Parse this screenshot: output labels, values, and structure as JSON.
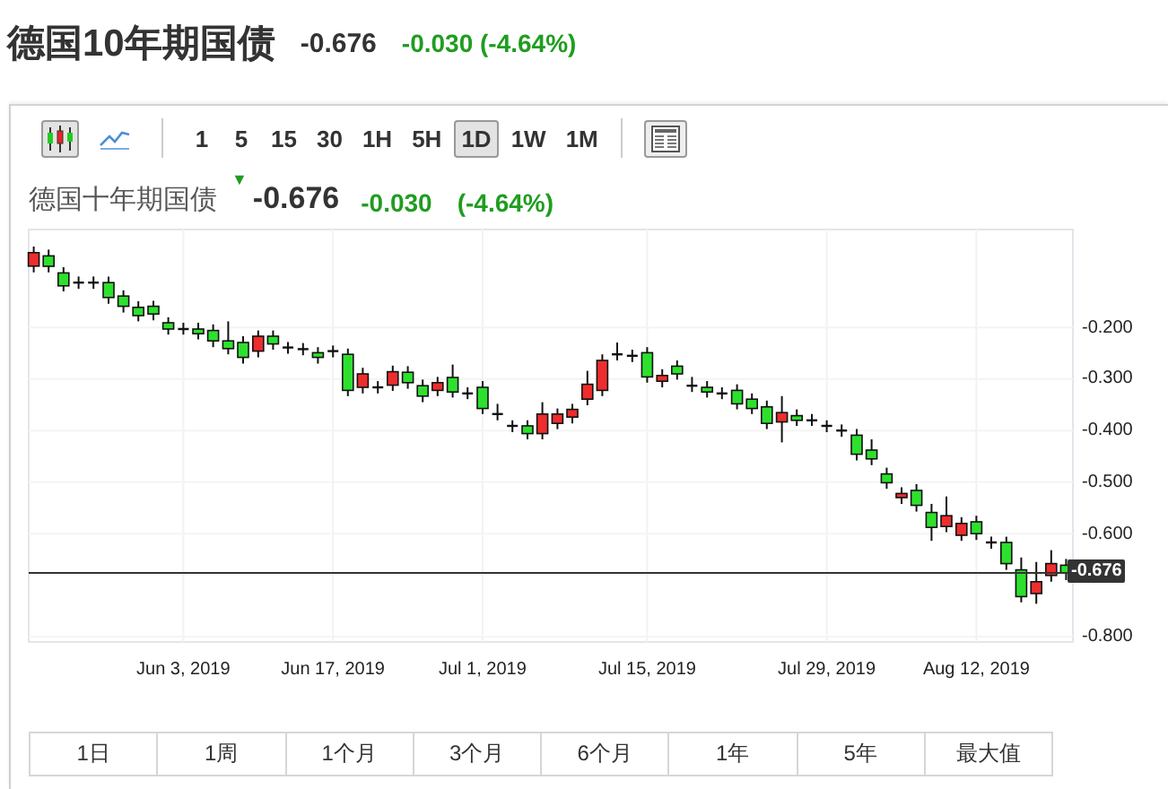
{
  "title": "德国10年期国债",
  "price": "-0.676",
  "change": "-0.030 (-4.64%)",
  "toolbar": {
    "chart_types": [
      {
        "kind": "candle",
        "selected": true
      },
      {
        "kind": "line",
        "selected": false
      }
    ],
    "intervals": [
      {
        "label": "1",
        "selected": false
      },
      {
        "label": "5",
        "selected": false
      },
      {
        "label": "15",
        "selected": false
      },
      {
        "label": "30",
        "selected": false
      },
      {
        "label": "1H",
        "selected": false
      },
      {
        "label": "5H",
        "selected": false
      },
      {
        "label": "1D",
        "selected": true
      },
      {
        "label": "1W",
        "selected": false
      },
      {
        "label": "1M",
        "selected": false
      }
    ]
  },
  "chart": {
    "name": "德国十年期国债",
    "trend_arrow": "▼",
    "price": "-0.676",
    "change": "-0.030",
    "change_percent": "(-4.64%)",
    "chart_data": {
      "type": "candlestick",
      "categories": [
        null,
        null,
        null,
        null,
        null,
        null,
        null,
        null,
        null,
        null,
        "Jun 3, 2019",
        null,
        null,
        null,
        null,
        null,
        null,
        null,
        null,
        null,
        "Jun 17, 2019",
        null,
        null,
        null,
        null,
        null,
        null,
        null,
        null,
        null,
        "Jul 1, 2019",
        null,
        null,
        null,
        null,
        null,
        null,
        null,
        null,
        null,
        null,
        "Jul 15, 2019",
        null,
        null,
        null,
        null,
        null,
        null,
        null,
        null,
        null,
        null,
        null,
        "Jul 29, 2019",
        null,
        null,
        null,
        null,
        null,
        null,
        null,
        null,
        null,
        "Aug 12, 2019",
        null,
        null,
        null,
        null,
        null,
        null
      ],
      "ohlc": [
        [
          -0.081,
          -0.043,
          -0.093,
          -0.055
        ],
        [
          -0.061,
          -0.049,
          -0.093,
          -0.081
        ],
        [
          -0.094,
          -0.083,
          -0.13,
          -0.119
        ],
        [
          -0.113,
          -0.101,
          -0.125,
          -0.113
        ],
        [
          -0.113,
          -0.101,
          -0.125,
          -0.113
        ],
        [
          -0.113,
          -0.101,
          -0.154,
          -0.142
        ],
        [
          -0.139,
          -0.128,
          -0.171,
          -0.159
        ],
        [
          -0.161,
          -0.149,
          -0.188,
          -0.177
        ],
        [
          -0.159,
          -0.148,
          -0.186,
          -0.174
        ],
        [
          -0.191,
          -0.18,
          -0.214,
          -0.203
        ],
        [
          -0.203,
          -0.191,
          -0.214,
          -0.203
        ],
        [
          -0.203,
          -0.191,
          -0.223,
          -0.212
        ],
        [
          -0.206,
          -0.194,
          -0.238,
          -0.226
        ],
        [
          -0.226,
          -0.188,
          -0.252,
          -0.241
        ],
        [
          -0.229,
          -0.217,
          -0.27,
          -0.258
        ],
        [
          -0.246,
          -0.206,
          -0.258,
          -0.217
        ],
        [
          -0.217,
          -0.206,
          -0.243,
          -0.232
        ],
        [
          -0.239,
          -0.228,
          -0.251,
          -0.239
        ],
        [
          -0.242,
          -0.23,
          -0.254,
          -0.242
        ],
        [
          -0.249,
          -0.238,
          -0.27,
          -0.258
        ],
        [
          -0.246,
          -0.235,
          -0.258,
          -0.246
        ],
        [
          -0.252,
          -0.241,
          -0.333,
          -0.322
        ],
        [
          -0.316,
          -0.278,
          -0.328,
          -0.29
        ],
        [
          -0.316,
          -0.304,
          -0.328,
          -0.316
        ],
        [
          -0.312,
          -0.274,
          -0.323,
          -0.286
        ],
        [
          -0.287,
          -0.275,
          -0.319,
          -0.307
        ],
        [
          -0.313,
          -0.301,
          -0.345,
          -0.333
        ],
        [
          -0.322,
          -0.296,
          -0.333,
          -0.307
        ],
        [
          -0.297,
          -0.272,
          -0.336,
          -0.325
        ],
        [
          -0.328,
          -0.316,
          -0.339,
          -0.328
        ],
        [
          -0.316,
          -0.304,
          -0.368,
          -0.357
        ],
        [
          -0.368,
          -0.348,
          -0.38,
          -0.368
        ],
        [
          -0.391,
          -0.38,
          -0.403,
          -0.391
        ],
        [
          -0.391,
          -0.38,
          -0.417,
          -0.406
        ],
        [
          -0.406,
          -0.345,
          -0.417,
          -0.368
        ],
        [
          -0.386,
          -0.357,
          -0.397,
          -0.368
        ],
        [
          -0.374,
          -0.348,
          -0.386,
          -0.359
        ],
        [
          -0.339,
          -0.284,
          -0.351,
          -0.31
        ],
        [
          -0.322,
          -0.252,
          -0.333,
          -0.264
        ],
        [
          -0.252,
          -0.229,
          -0.264,
          -0.252
        ],
        [
          -0.255,
          -0.243,
          -0.267,
          -0.255
        ],
        [
          -0.249,
          -0.238,
          -0.307,
          -0.296
        ],
        [
          -0.304,
          -0.281,
          -0.316,
          -0.293
        ],
        [
          -0.275,
          -0.264,
          -0.301,
          -0.29
        ],
        [
          -0.313,
          -0.296,
          -0.325,
          -0.313
        ],
        [
          -0.316,
          -0.304,
          -0.336,
          -0.325
        ],
        [
          -0.328,
          -0.316,
          -0.339,
          -0.328
        ],
        [
          -0.322,
          -0.31,
          -0.359,
          -0.348
        ],
        [
          -0.339,
          -0.328,
          -0.368,
          -0.357
        ],
        [
          -0.354,
          -0.342,
          -0.397,
          -0.386
        ],
        [
          -0.383,
          -0.333,
          -0.423,
          -0.365
        ],
        [
          -0.371,
          -0.359,
          -0.391,
          -0.38
        ],
        [
          -0.38,
          -0.368,
          -0.391,
          -0.38
        ],
        [
          -0.391,
          -0.38,
          -0.403,
          -0.391
        ],
        [
          -0.4,
          -0.388,
          -0.412,
          -0.4
        ],
        [
          -0.409,
          -0.397,
          -0.458,
          -0.446
        ],
        [
          -0.438,
          -0.417,
          -0.467,
          -0.455
        ],
        [
          -0.484,
          -0.472,
          -0.513,
          -0.501
        ],
        [
          -0.53,
          -0.51,
          -0.542,
          -0.522
        ],
        [
          -0.516,
          -0.504,
          -0.557,
          -0.545
        ],
        [
          -0.559,
          -0.542,
          -0.614,
          -0.588
        ],
        [
          -0.586,
          -0.528,
          -0.597,
          -0.565
        ],
        [
          -0.603,
          -0.568,
          -0.614,
          -0.58
        ],
        [
          -0.577,
          -0.565,
          -0.612,
          -0.6
        ],
        [
          -0.617,
          -0.606,
          -0.629,
          -0.617
        ],
        [
          -0.617,
          -0.606,
          -0.67,
          -0.658
        ],
        [
          -0.67,
          -0.646,
          -0.733,
          -0.722
        ],
        [
          -0.716,
          -0.655,
          -0.736,
          -0.693
        ],
        [
          -0.681,
          -0.632,
          -0.693,
          -0.658
        ],
        [
          -0.661,
          -0.649,
          -0.69,
          -0.676
        ]
      ],
      "ylim": [
        -0.81,
        -0.01
      ],
      "grid": true,
      "ref_lines": [
        {
          "axis": "y",
          "value": -0.676,
          "label": "-0.676"
        }
      ],
      "yticks": [
        {
          "value": -0.2,
          "label": "-0.200"
        },
        {
          "value": -0.3,
          "label": "-0.300"
        },
        {
          "value": -0.4,
          "label": "-0.400"
        },
        {
          "value": -0.5,
          "label": "-0.500"
        },
        {
          "value": -0.6,
          "label": "-0.600"
        },
        {
          "value": -0.8,
          "label": "-0.800"
        }
      ]
    }
  },
  "ranges": [
    "1日",
    "1周",
    "1个月",
    "3个月",
    "6个月",
    "1年",
    "5年",
    "最大值"
  ]
}
